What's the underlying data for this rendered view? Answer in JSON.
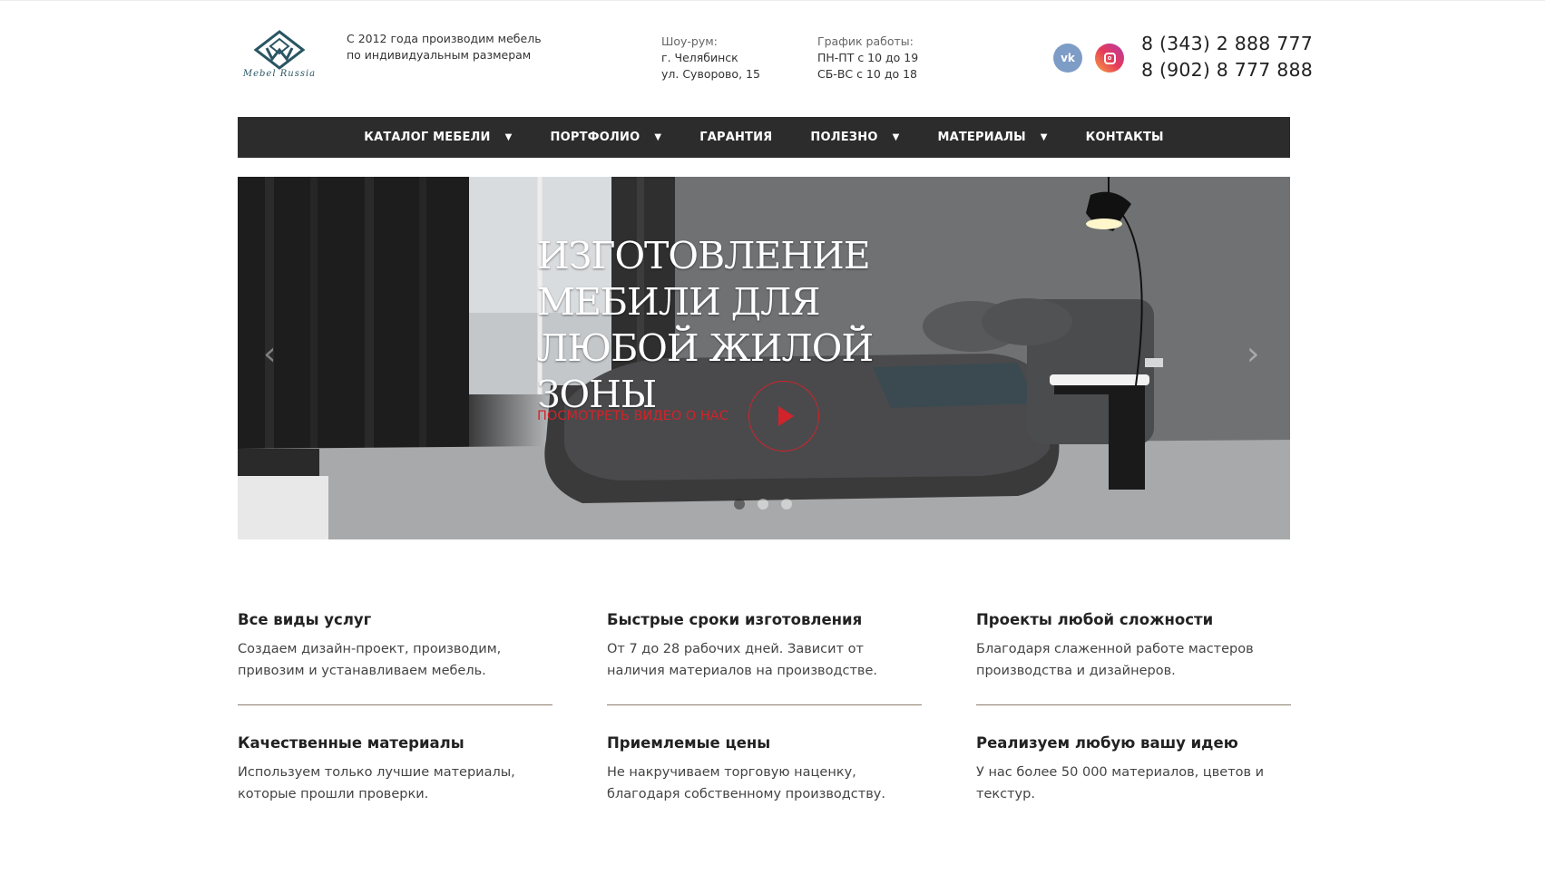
{
  "header": {
    "logo_text": "Mebel Russia",
    "tagline": "С 2012 года производим мебель по индивидуальным размерам",
    "showroom": {
      "label": "Шоу-рум:",
      "city": "г. Челябинск",
      "address": "ул. Суворово, 15"
    },
    "hours": {
      "label": "График работы:",
      "weekdays": "ПН-ПТ с 10 до 19",
      "weekend": "СБ-ВС с 10 до 18"
    },
    "social": {
      "vk_label": "vk",
      "vk_icon": "vk-icon",
      "ig_icon": "instagram-icon"
    },
    "phones": [
      "8 (343) 2 888 777",
      "8 (902) 8 777 888"
    ]
  },
  "nav": {
    "items": [
      {
        "label": "КАТАЛОГ МЕБЕЛИ",
        "dropdown": true
      },
      {
        "label": "ПОРТФОЛИО",
        "dropdown": true
      },
      {
        "label": "ГАРАНТИЯ",
        "dropdown": false
      },
      {
        "label": "ПОЛЕЗНО",
        "dropdown": true
      },
      {
        "label": "МАТЕРИАЛЫ",
        "dropdown": true
      },
      {
        "label": "КОНТАКТЫ",
        "dropdown": false
      }
    ],
    "arrow_glyph": "▼"
  },
  "hero": {
    "title": "Изготовление мебили для любой жилой зоны",
    "video_link": "Посмотреть видео о нас",
    "prev_glyph": "‹",
    "next_glyph": "›",
    "slides": 3,
    "active_slide": 1
  },
  "features": [
    {
      "title": "Все виды услуг",
      "text": "Создаем дизайн-проект, производим, привозим и устанавливаем мебель."
    },
    {
      "title": "Быстрые сроки изготовления",
      "text": "От 7 до 28 рабочих дней. Зависит от наличия материалов на производстве."
    },
    {
      "title": "Проекты любой сложности",
      "text": "Благодаря слаженной работе мастеров производства и дизайнеров."
    },
    {
      "title": "Качественные материалы",
      "text": "Используем только лучшие материалы, которые прошли проверки."
    },
    {
      "title": "Приемлемые цены",
      "text": "Не накручиваем торговую наценку, благодаря собственному производству."
    },
    {
      "title": "Реализуем любую вашу идею",
      "text": "У нас более 50 000 материалов, цветов и текстур."
    }
  ],
  "colors": {
    "nav_bg": "#2c2c2c",
    "accent_red": "#d2232a",
    "divider": "#8b7d6b",
    "logo": "#2b5563"
  }
}
